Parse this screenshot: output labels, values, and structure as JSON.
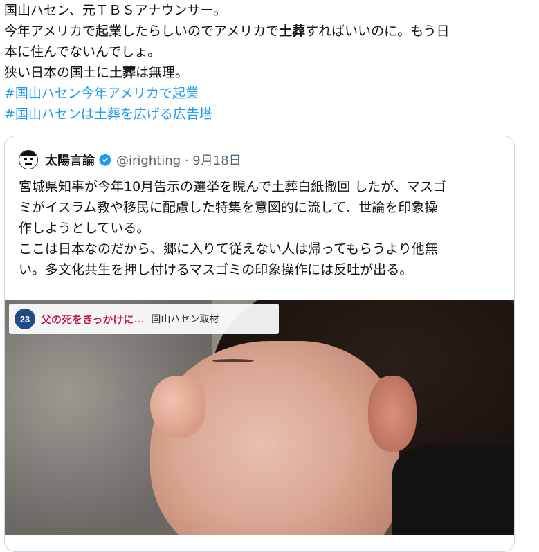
{
  "tweet": {
    "line1": "国山ハセン、元ＴＢＳアナウンサー。",
    "line2_pre": "今年アメリカで起業したらしいのでアメリカで",
    "line2_bold": "土葬",
    "line2_post": "すればいいのに。もう日",
    "line3": "本に住んでないんでしょ。",
    "line4_pre": "狭い日本の国土に",
    "line4_bold": "土葬",
    "line4_post": "は無理。",
    "hashtag1": "#国山ハセン今年アメリカで起業",
    "hashtag2": "#国山ハセンは土葬を広げる広告塔"
  },
  "quote": {
    "author_name": "太陽言論",
    "handle_date": "@irighting · 9月18日",
    "lines": [
      "宮城県知事が今年10月告示の選挙を睨んで土葬白紙撤回 したが、マスゴ",
      "ミがイスラム教や移民に配慮した特集を意図的に流して、世論を印象操",
      "作しようとしている。",
      "ここは日本なのだから、郷に入りて従えない人は帰ってもらうより他無",
      "い。多文化共生を押し付けるマスゴミの印象操作には反吐が出る。"
    ]
  },
  "video": {
    "logo_text": "23",
    "caption_main": "父の死をきっかけに",
    "caption_ellipsis": "…",
    "caption_sub": "国山ハセン取材"
  },
  "colors": {
    "hashtag": "#1d9bf0",
    "verified": "#1d9bf0",
    "caption": "#c2185b"
  }
}
